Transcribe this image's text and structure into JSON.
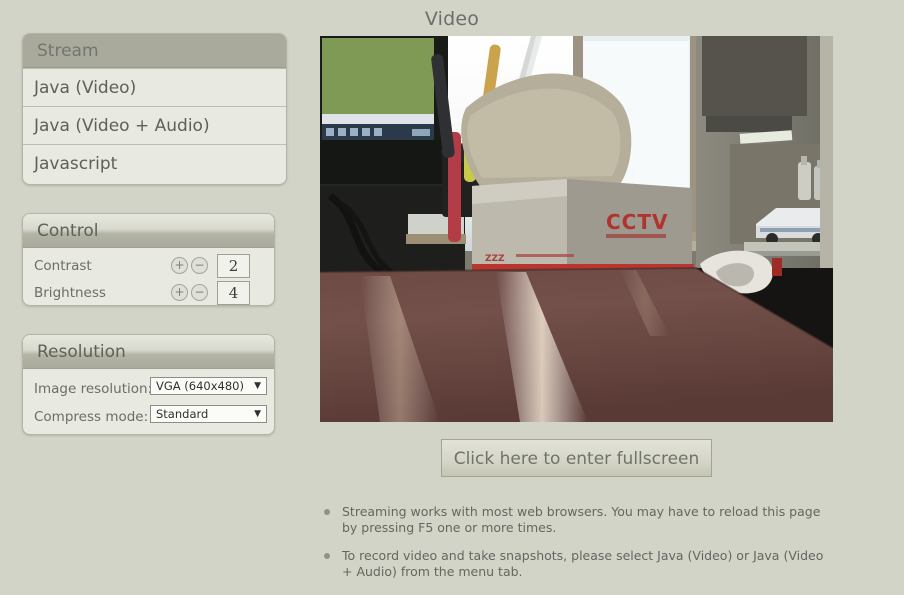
{
  "page": {
    "title": "Video",
    "background_color": "#d3d4c8"
  },
  "stream_panel": {
    "header": "Stream",
    "items": [
      {
        "label": "Java (Video)"
      },
      {
        "label": "Java (Video + Audio)"
      },
      {
        "label": "Javascript"
      }
    ]
  },
  "control_panel": {
    "header": "Control",
    "rows": [
      {
        "label": "Contrast",
        "plus": "+",
        "minus": "−",
        "value": "2"
      },
      {
        "label": "Brightness",
        "plus": "+",
        "minus": "−",
        "value": "4"
      }
    ]
  },
  "resolution_panel": {
    "header": "Resolution",
    "rows": [
      {
        "label": "Image resolution:",
        "value": "VGA (640x480)",
        "arrow": "▼"
      },
      {
        "label": "Compress mode:",
        "value": "Standard",
        "arrow": "▼"
      }
    ]
  },
  "video": {
    "alt": "Live camera view of an office desk: computer monitor, pen holder, a CCTV box, a bright window and a shelf holding a model car above a dark wooden desktop."
  },
  "fullscreen_button": {
    "label": "Click here to enter fullscreen"
  },
  "notes": [
    {
      "text": "Streaming works with most web browsers. You may have to reload this page by pressing F5 one or more times."
    },
    {
      "text": "To record video and take snapshots, please select Java (Video) or Java (Video + Audio) from the menu tab."
    }
  ]
}
